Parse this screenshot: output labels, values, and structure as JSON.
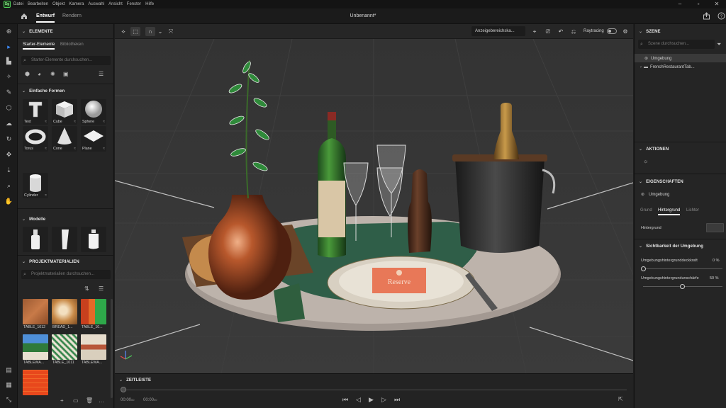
{
  "menubar": {
    "logo": "Sg",
    "items": [
      "Datei",
      "Bearbeiten",
      "Objekt",
      "Kamera",
      "Auswahl",
      "Ansicht",
      "Fenster",
      "Hilfe"
    ]
  },
  "titlebar": {
    "tabs": [
      "Entwurf",
      "Rendern"
    ],
    "active_tab": "Entwurf",
    "document_title": "Unbenannt*"
  },
  "left_panel": {
    "elements_header": "ELEMENTE",
    "subtabs": [
      "Starter-Elemente",
      "Bibliotheken"
    ],
    "search_placeholder": "Starter-Elemente durchsuchen...",
    "simple_shapes_header": "Einfache Formen",
    "shapes": [
      "Text",
      "Cube",
      "Sphere",
      "Torus",
      "Cone",
      "Plane",
      "Cylinder"
    ],
    "models_header": "Modelle",
    "materials_header": "PROJEKTMATERIALIEN",
    "materials_search_placeholder": "Projektmaterialien durchsuchen...",
    "materials": [
      "TABLE_1012",
      "BREAD_1...",
      "TABLE_10...",
      "TABLEWA...",
      "TABLE_1011",
      "TABLEWA..."
    ]
  },
  "viewport": {
    "view_select": "Anzeigebereichska...",
    "raytracing_label": "Raytracing",
    "raytracing_on": false,
    "place_card_text": "Reserve"
  },
  "timeline": {
    "header": "ZEITLEISTE",
    "current_time": "00:00",
    "current_frames": "00",
    "total_time": "00:00",
    "total_frames": "00"
  },
  "right_panel": {
    "scene_header": "SZENE",
    "scene_search_placeholder": "Szene durchsuchen...",
    "scene_items": [
      "Umgebung",
      "FrenchRestaurantTab..."
    ],
    "actions_header": "AKTIONEN",
    "properties_header": "EIGENSCHAFTEN",
    "properties_object": "Umgebung",
    "property_tabs": [
      "Grund",
      "Hintergrund",
      "Lichter"
    ],
    "active_property_tab": "Hintergrund",
    "background_label": "Hintergrund",
    "visibility_header": "Sichtbarkeit der Umgebung",
    "opacity_label": "Umgebungshintergrunddeckkraft",
    "opacity_value": "0 %",
    "sharpness_label": "Umgebungshintergrundunschärfe",
    "sharpness_value": "50 %"
  },
  "colors": {
    "accent_blue": "#3d8cff",
    "panel_bg": "#252525",
    "viewport_bg": "#373737",
    "logo_green": "#4fd05a"
  }
}
